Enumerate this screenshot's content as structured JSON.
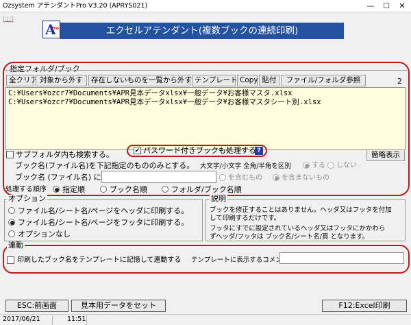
{
  "window": {
    "title": "Ozsystem アテンダントPro V3.20 (APRYS021)",
    "minimize_icon": "minimize-icon",
    "maximize_icon": "maximize-icon",
    "close_icon": "close-icon",
    "minimize_glyph": "—",
    "maximize_glyph": "☐",
    "close_glyph": "✕"
  },
  "header": {
    "book_icon": "book-icon",
    "book_glyph": "📖",
    "logo_letter": "A",
    "logo_sub": "Pro",
    "banner_title": "エクセルアテンダント(複数ブックの連続印刷)",
    "banner_color": "#2452a3",
    "page_number": "2"
  },
  "folder_section": {
    "label": "指定フォルダ/ブック",
    "toolbar": [
      "全クリア",
      "対象から外す",
      "存在しないものを一覧から外す",
      "テンプレート",
      "Copy",
      "貼付",
      "ファイル/フォルダ参照"
    ],
    "files": [
      "C:¥Users¥ozcr7¥Documents¥APR見本データxlsx¥一般データ¥お客様マスタ.xlsx",
      "C:¥Users¥ozcr7¥Documents¥APR見本データxlsx¥一般データ¥お客様マスタシート別.xlsx"
    ],
    "list_bg": "#fffddc",
    "subfolder_label": "サブフォルダ内も検索する。",
    "subfolder_checked": false,
    "password_label": "パスワード付きブックも処理する",
    "password_checked": true,
    "help_glyph": "?",
    "simple_display_button": "簡略表示",
    "bookname_note": "ブック名(ファイル名)を下記指定のもののみとする。",
    "case_label": "大文字/小文字 全角/半角を区別",
    "case_options": [
      {
        "label": "する",
        "selected": true
      },
      {
        "label": "しない",
        "selected": false
      }
    ],
    "bookname_input_label": "ブック名 (ファイル名) に",
    "bookname_value": "",
    "match_options": [
      {
        "label": "を含むもの",
        "selected": false
      },
      {
        "label": "を含まないもの",
        "selected": true
      }
    ],
    "order_label": "処理する順序",
    "order_options": [
      {
        "label": "指定順",
        "selected": true
      },
      {
        "label": "ブック名順",
        "selected": false
      },
      {
        "label": "フォルダ/ブック名順",
        "selected": false
      }
    ]
  },
  "options_section": {
    "label": "オプション",
    "options": [
      {
        "label": "ファイル名/シート名/ページをヘッダに印刷する。",
        "selected": false
      },
      {
        "label": "ファイル名/シート名/ページをフッタに印刷する。",
        "selected": true
      },
      {
        "label": "オプションなし",
        "selected": false
      }
    ]
  },
  "description_section": {
    "label": "説明",
    "lines": [
      "ブックを修正することはありません。ヘッダ又はフッタを付加",
      "して印刷するだけです。",
      "フッタにすでに設定されているヘッダ又はフッタにかかわら",
      "ずヘッダ/フッタは ブック名/シート名/頁 となります。"
    ]
  },
  "link_section": {
    "label": "連動",
    "checkbox_label": "印刷したブック名をテンプレートに記憶して連動する",
    "checked": false,
    "comment_label": "テンプレートに表示するコメント",
    "comment_value": ""
  },
  "footer": {
    "esc_button": "ESC:前画面",
    "sample_button": "見本用データをセット",
    "f12_button": "F12:Excel印刷"
  },
  "status_bar": {
    "date": "2017/06/21",
    "time": "11:51"
  },
  "colors": {
    "highlight_ring": "#c01818",
    "banner": "#2452a3"
  }
}
